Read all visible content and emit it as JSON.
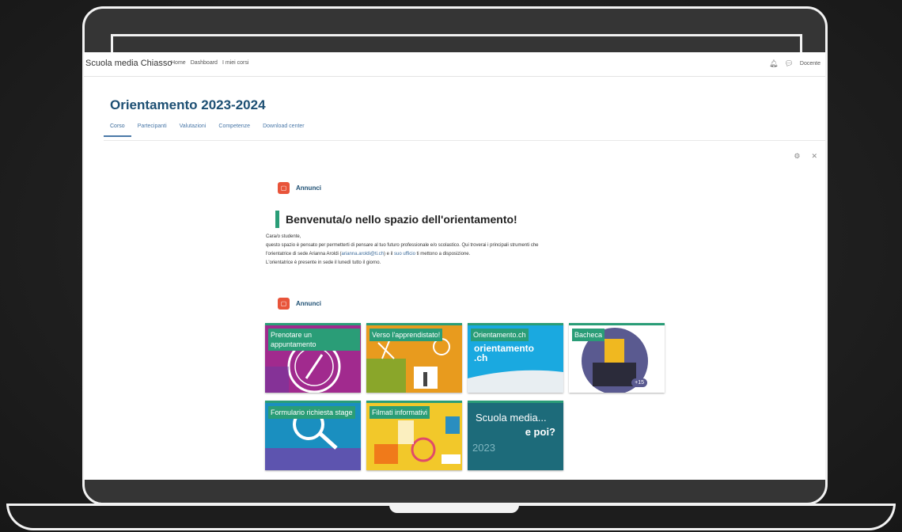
{
  "navbar": {
    "site_name": "Scuola media Chiasso",
    "links": [
      "Home",
      "Dashboard",
      "I miei corsi"
    ],
    "user": "Docente"
  },
  "course": {
    "title": "Orientamento 2023-2024",
    "tabs": [
      "Corso",
      "Partecipanti",
      "Valutazioni",
      "Competenze",
      "Download center"
    ]
  },
  "announce_1": "Annunci",
  "announce_2": "Annunci",
  "welcome": {
    "title": "Benvenuta/o nello spazio dell'orientamento!",
    "greeting": "Cara/o studente,",
    "line1": "questo spazio è pensato per permetterti di pensare al tuo futuro professionale e/o scolastico. Qui troverai i principali strumenti che",
    "line2a": "l'orientatrice di sede Arianna Aroldi (",
    "email": "arianna.aroldi@ti.ch",
    "line2b": ") e il ",
    "office": "suo ufficio",
    "line2c": " ti mettono a disposizione.",
    "line3": "L'orientatrice è presente in sede il lunedì tutto il giorno."
  },
  "tiles": [
    {
      "label": "Prenotare un appuntamento",
      "color": "#a12a8e"
    },
    {
      "label": "Verso l'apprendistato!",
      "color": "#e89b1e"
    },
    {
      "label": "Orientamento.ch",
      "color": "#1aa9e0",
      "logo_line1": "orientamento",
      "logo_line2": ".ch"
    },
    {
      "label": "Bacheca",
      "color": "#ffffff",
      "badge": "+15"
    },
    {
      "label": "Formulario richiesta stage",
      "color": "#1a8fc0"
    },
    {
      "label": "Filmati informativi",
      "color": "#f2c82a"
    },
    {
      "label": "Scuola media... e poi?",
      "color": "#1d6b7a",
      "line1": "Scuola media...",
      "line2": "e poi?",
      "year": "2023"
    }
  ]
}
